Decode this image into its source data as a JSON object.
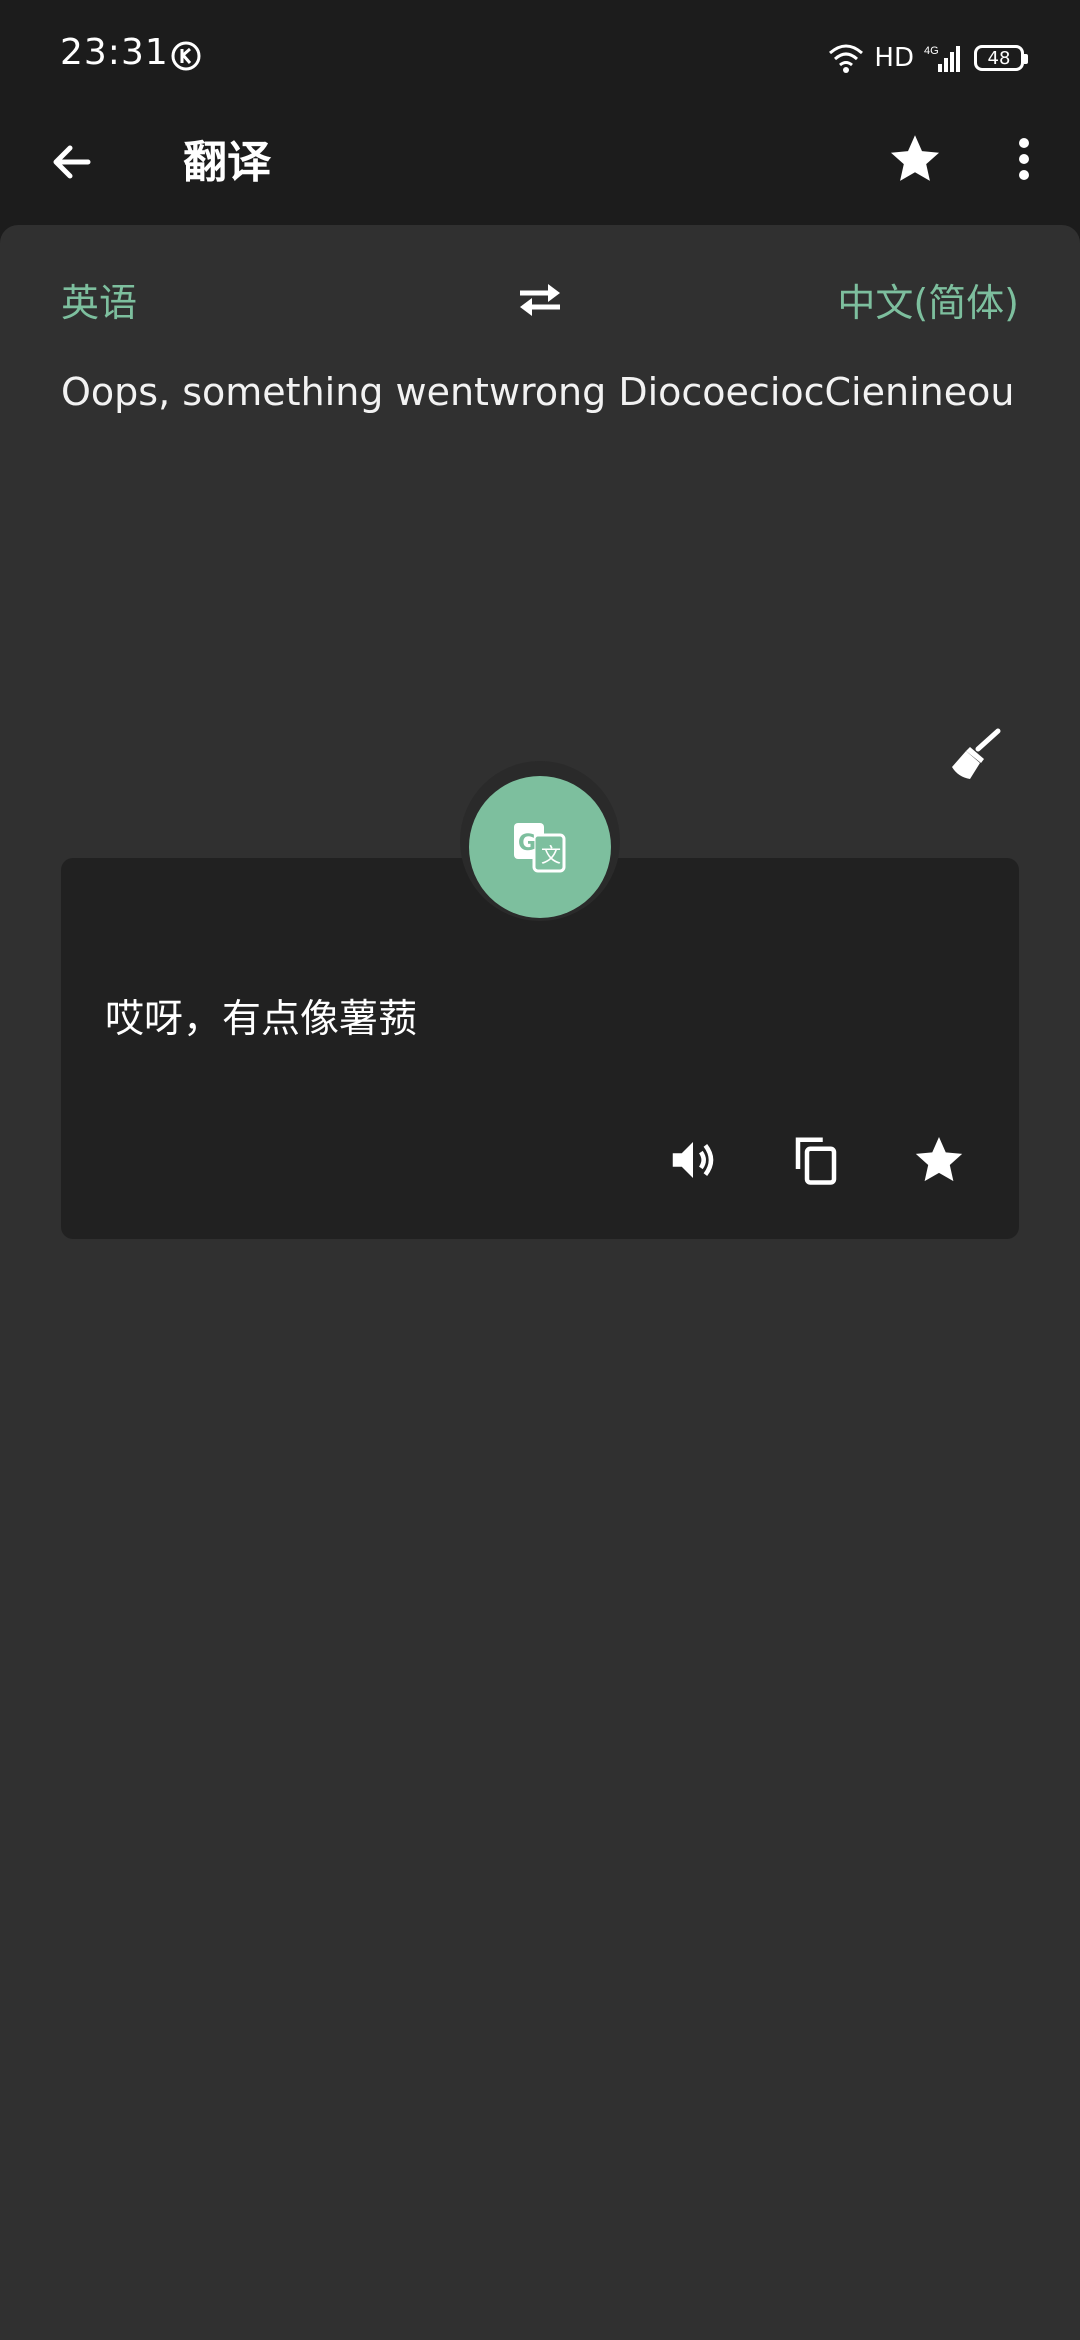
{
  "status": {
    "time": "23:31",
    "network": "HD",
    "signal": "4G",
    "battery": "48"
  },
  "app_bar": {
    "title": "翻译"
  },
  "languages": {
    "source": "英语",
    "target": "中文(简体)"
  },
  "input": {
    "text": "Oops, something wentwrong DiocoeciocCienineou"
  },
  "result": {
    "text": "哎呀，有点像薯蓣"
  },
  "colors": {
    "accent": "#7dbf9e",
    "background": "#303030",
    "card": "#212121",
    "bar": "#1c1c1c"
  }
}
